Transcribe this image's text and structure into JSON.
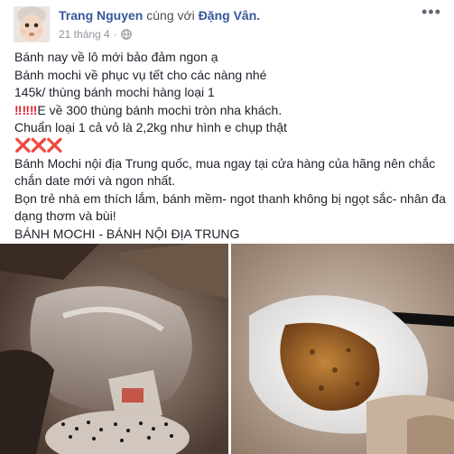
{
  "post": {
    "author": "Trang Nguyen",
    "with_text": "cùng với",
    "tagged": "Đặng Vân.",
    "timestamp": "21 tháng 4",
    "privacy_icon": "public-globe-icon",
    "lines": [
      "Bánh nay về lô mới bảo đảm ngon ạ",
      "Bánh mochi về phục vụ tết cho các nàng nhé",
      "145k/ thùng bánh mochi hàng loại 1",
      "E về 300 thùng bánh mochi tròn nha khách.",
      "Chuẩn loại 1 cả vỏ là 2,2kg như hình e chụp thật",
      "Bánh Mochi nội địa Trung quốc, mua ngay tại cửa hàng của hãng nên chắc chắn date mới và ngon nhất.",
      "Bọn trẻ nhà em thích lắm, bánh mềm- ngot thanh không bị ngọt sắc- nhân đa dạng thơm và bùi!",
      "BÁNH MOCHI - BÁNH NỘI ĐỊA TRUNG"
    ],
    "emoji_exclaim": "‼‼‼",
    "emoji_cross": "❌❌❌"
  },
  "photos": [
    {
      "name": "mochi-box-photo"
    },
    {
      "name": "mochi-bite-photo"
    }
  ]
}
